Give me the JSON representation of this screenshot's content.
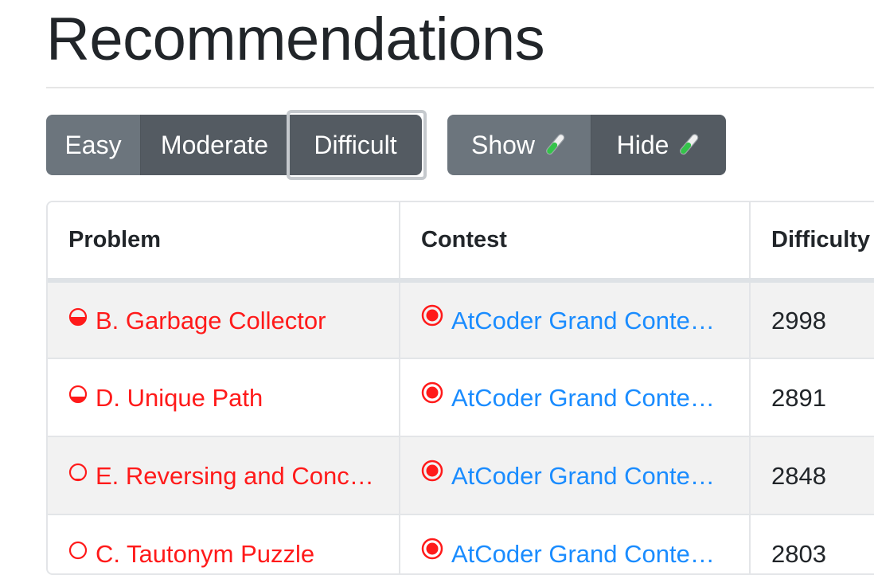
{
  "page": {
    "title": "Recommendations"
  },
  "difficulty_filter": {
    "buttons": [
      {
        "label": "Easy"
      },
      {
        "label": "Moderate"
      },
      {
        "label": "Difficult",
        "selected": true
      }
    ]
  },
  "experimental_toggle": {
    "show_label": "Show",
    "hide_label": "Hide",
    "icon": "test-tube-icon"
  },
  "table": {
    "headers": [
      "Problem",
      "Contest",
      "Difficulty"
    ],
    "rows": [
      {
        "problem": "B. Garbage Collector",
        "problem_fill": 0.5,
        "contest": "AtCoder Grand Conte…",
        "difficulty": "2998"
      },
      {
        "problem": "D. Unique Path",
        "problem_fill": 0.35,
        "contest": "AtCoder Grand Conte…",
        "difficulty": "2891"
      },
      {
        "problem": "E. Reversing and Conc…",
        "problem_fill": 0.1,
        "contest": "AtCoder Grand Conte…",
        "difficulty": "2848"
      },
      {
        "problem": "C. Tautonym Puzzle",
        "problem_fill": 0.0,
        "contest": "AtCoder Grand Conte…",
        "difficulty": "2803"
      }
    ]
  },
  "colors": {
    "problem_red": "#ff1a1a",
    "contest_blue": "#1a8cff",
    "button_gray": "#6c757d",
    "button_active": "#545b62"
  }
}
